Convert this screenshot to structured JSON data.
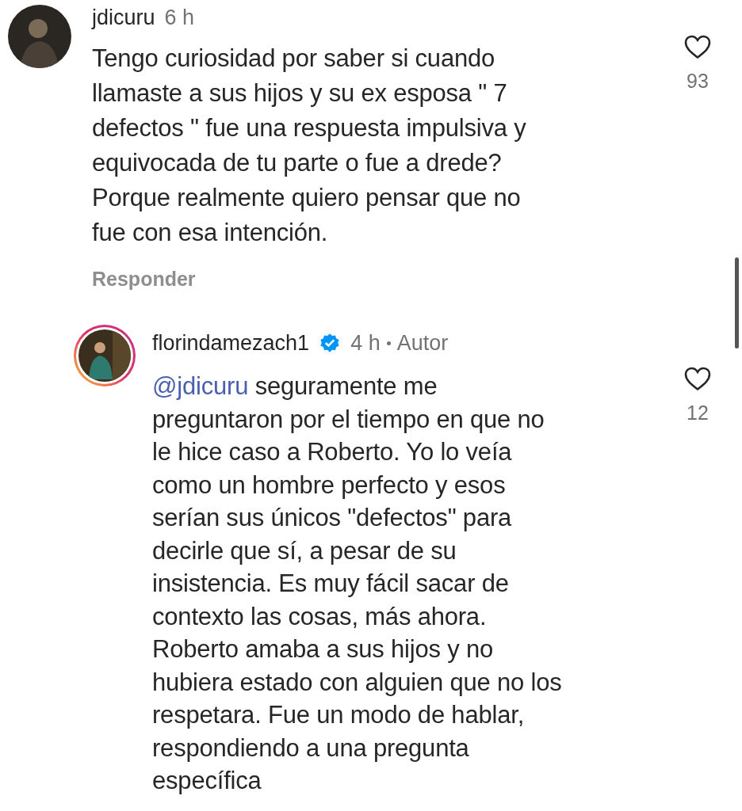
{
  "comments": [
    {
      "username": "jdicuru",
      "verified": false,
      "time": "6 h",
      "is_reply": false,
      "text": "Tengo curiosidad por saber si cuando\nllamaste a sus hijos y su ex esposa \" 7\ndefectos \" fue una respuesta impulsiva y\nequivocada de tu parte o fue a drede?\nPorque realmente quiero pensar que no\nfue con esa intención.",
      "likes": "93",
      "liked": false,
      "reply_action": "Responder",
      "story_ring": false
    },
    {
      "username": "florindamezach1",
      "verified": true,
      "time": "4 h",
      "author_label": "Autor",
      "is_reply": true,
      "mention": "@jdicuru",
      "text": "seguramente me\npreguntaron por el tiempo en que no\nle hice caso a Roberto. Yo lo veía\ncomo un hombre perfecto y esos\nserían sus únicos \"defectos\" para\ndecirle que sí, a pesar de su\ninsistencia. Es muy fácil sacar de\ncontexto las cosas, más ahora.\nRoberto amaba a sus hijos y no\nhubiera estado con alguien que no los\nrespetara. Fue un modo de hablar,\nrespondiendo a una pregunta\nespecífica",
      "likes": "12",
      "liked": false,
      "story_ring": true
    }
  ]
}
